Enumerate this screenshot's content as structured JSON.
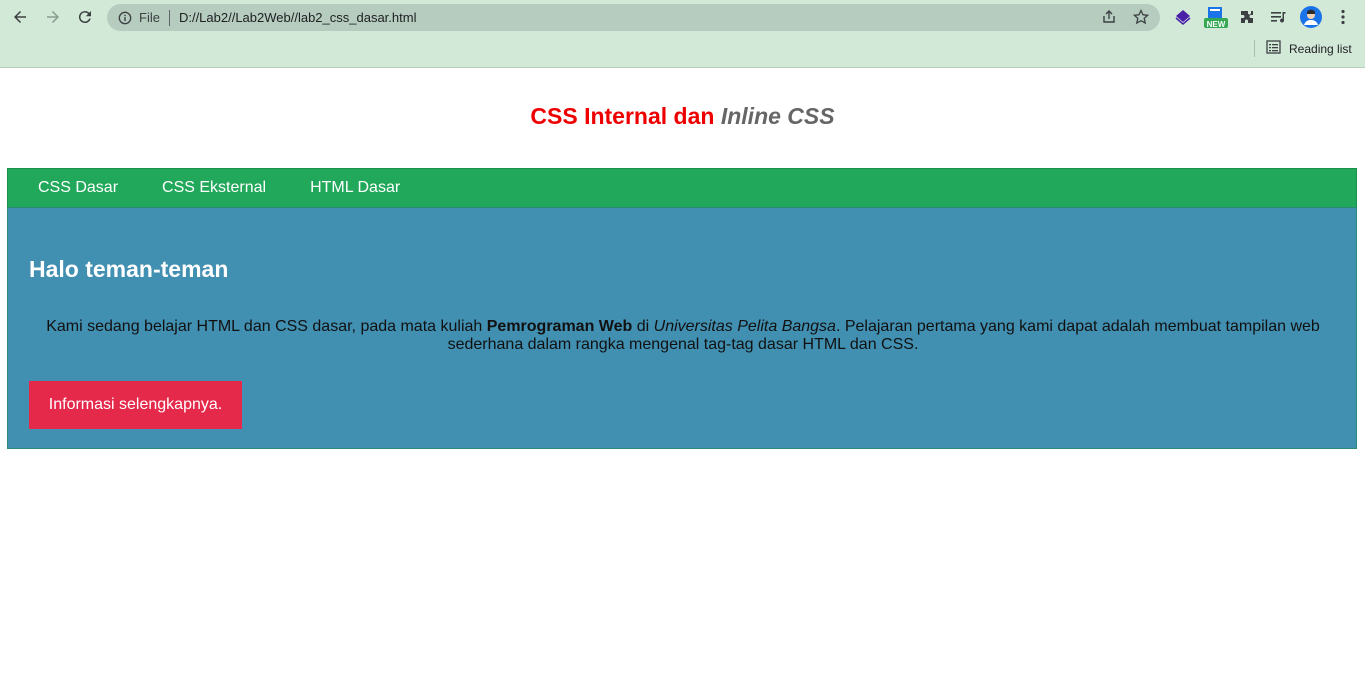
{
  "browser": {
    "address_prefix": "File",
    "url": "D://Lab2//Lab2Web//lab2_css_dasar.html",
    "reading_list_label": "Reading list",
    "new_badge": "NEW",
    "colors": {
      "chrome_bg": "#d3e9d8",
      "omnibox_bg": "#b5ccbf"
    }
  },
  "page": {
    "title_part1": "CSS Internal dan",
    "title_italic": "Inline",
    "title_part2": "CSS",
    "menu": [
      {
        "label": "CSS Dasar"
      },
      {
        "label": "CSS Eksternal"
      },
      {
        "label": "HTML Dasar"
      }
    ],
    "content": {
      "heading": "Halo teman-teman",
      "paragraph_start": "Kami sedang belajar HTML dan CSS dasar, pada mata kuliah",
      "paragraph_bold": "Pemrograman Web",
      "paragraph_mid": "di",
      "paragraph_italic": "Universitas Pelita Bangsa",
      "paragraph_end": ". Pelajaran pertama yang kami dapat adalah membuat tampilan web sederhana dalam rangka mengenal tag-tag dasar HTML dan CSS.",
      "button_label": "Informasi selengkapnya."
    },
    "colors": {
      "title_red": "#ee0000",
      "title_grey": "#666666",
      "menu_bg": "#22a85a",
      "content_bg": "#418fb1",
      "button_bg": "#e5294b"
    }
  },
  "icons": [
    "back-icon",
    "forward-icon",
    "reload-icon",
    "info-icon",
    "share-icon",
    "star-icon",
    "extension-diamond-icon",
    "extension-new-icon",
    "puzzle-icon",
    "media-control-icon",
    "avatar",
    "menu-dots-icon",
    "reading-list-icon"
  ]
}
